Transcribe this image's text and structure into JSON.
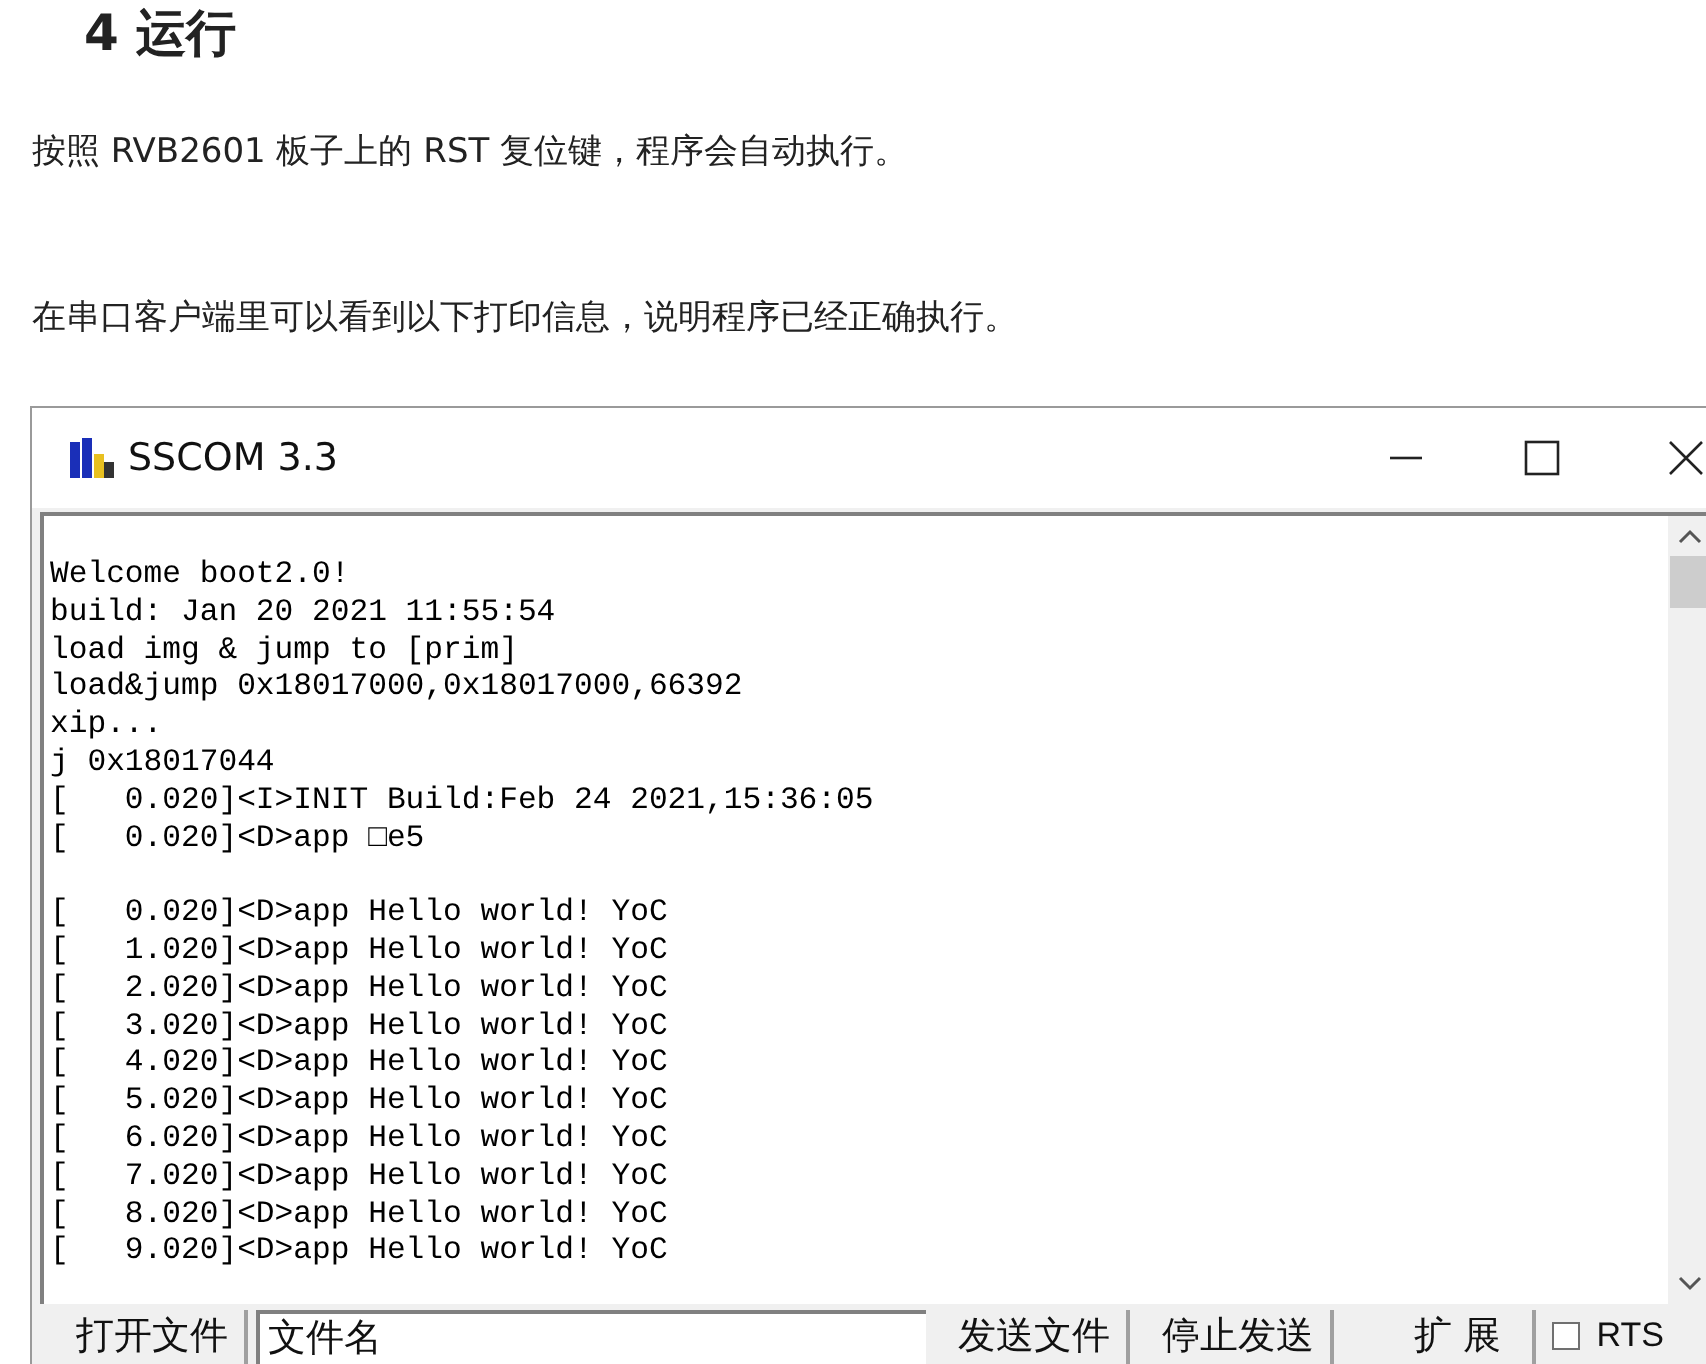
{
  "heading": "4 运行",
  "paragraphs": [
    "按照 RVB2601 板子上的 RST 复位键，程序会自动执行。",
    "在串口客户端里可以看到以下打印信息，说明程序已经正确执行。"
  ],
  "window": {
    "title": "SSCOM 3.3",
    "log_blocks": [
      [
        "Welcome boot2.0!",
        "build: Jan 20 2021 11:55:54",
        "load img & jump to [prim]",
        "load&jump 0x18017000,0x18017000,66392",
        "xip...",
        "j 0x18017044",
        "[   0.020]<I>INIT Build:Feb 24 2021,15:36:05",
        "[   0.020]<D>app □e5"
      ],
      [
        "[   0.020]<D>app Hello world! YoC",
        "[   1.020]<D>app Hello world! YoC",
        "[   2.020]<D>app Hello world! YoC",
        "[   3.020]<D>app Hello world! YoC",
        "[   4.020]<D>app Hello world! YoC",
        "[   5.020]<D>app Hello world! YoC",
        "[   6.020]<D>app Hello world! YoC",
        "[   7.020]<D>app Hello world! YoC",
        "[   8.020]<D>app Hello world! YoC",
        "[   9.020]<D>app Hello world! YoC"
      ]
    ],
    "toolbar": [
      {
        "kind": "button",
        "label": "打开文件"
      },
      {
        "kind": "field",
        "value": "文件名"
      },
      {
        "kind": "button",
        "label": "发送文件"
      },
      {
        "kind": "button",
        "label": "停止发送"
      },
      {
        "kind": "button",
        "label": "扩 展"
      },
      {
        "kind": "checkbox",
        "label": "RTS",
        "checked": false
      }
    ]
  }
}
